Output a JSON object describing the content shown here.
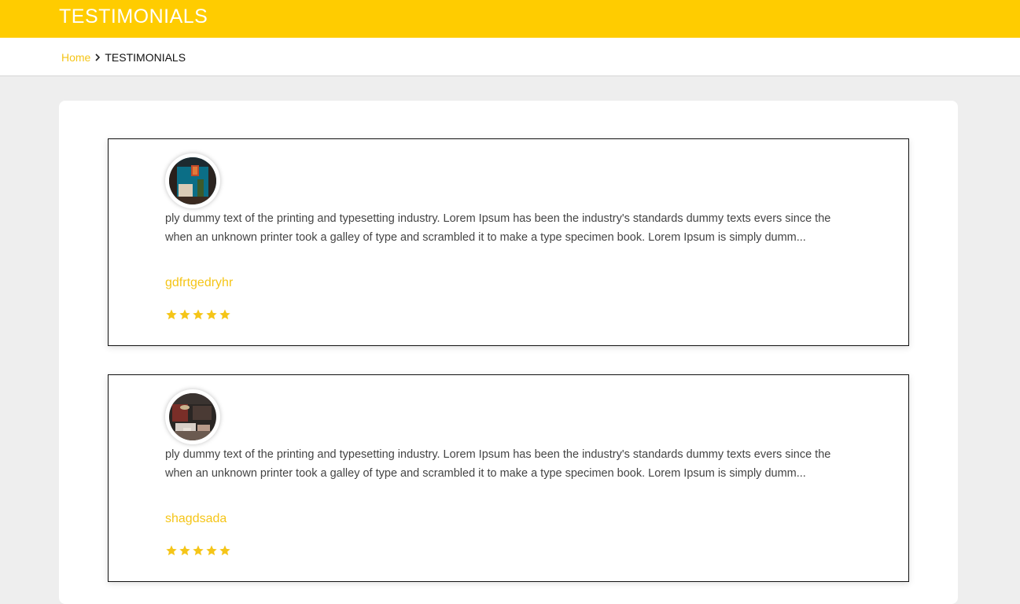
{
  "header": {
    "title": "TESTIMONIALS",
    "background_color": "#ffcc00"
  },
  "breadcrumb": {
    "home_label": "Home",
    "separator_icon": "chevron-right-icon",
    "current_label": "TESTIMONIALS",
    "home_color": "#f5c518"
  },
  "testimonials": [
    {
      "avatar_icon": "avatar-image-blue-interior",
      "text": "ply dummy text of the printing and typesetting industry. Lorem Ipsum has been the industry's standards dummy texts evers since the when an unknown printer took a galley of type and scrambled it to make a type specimen book. Lorem Ipsum is simply dumm...",
      "author": "gdfrtgedryhr",
      "rating": 5,
      "rating_max": 5
    },
    {
      "avatar_icon": "avatar-image-living-room",
      "text": "ply dummy text of the printing and typesetting industry. Lorem Ipsum has been the industry's standards dummy texts evers since the when an unknown printer took a galley of type and scrambled it to make a type specimen book. Lorem Ipsum is simply dumm...",
      "author": "shagdsada",
      "rating": 5,
      "rating_max": 5
    }
  ],
  "colors": {
    "accent": "#f5c518",
    "page_background": "#eeeeee",
    "card_background": "#ffffff",
    "text": "#444444"
  }
}
